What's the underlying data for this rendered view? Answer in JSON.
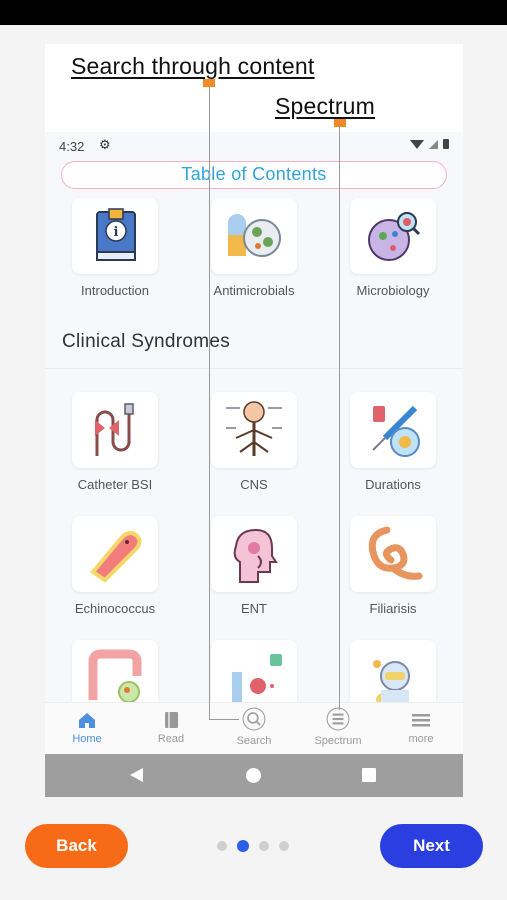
{
  "callouts": {
    "search": "Search through content",
    "spectrum": "Spectrum"
  },
  "status": {
    "time": "4:32"
  },
  "toc": {
    "title": "Table of Contents"
  },
  "top_items": [
    {
      "label": "Introduction",
      "icon": "info-book-icon"
    },
    {
      "label": "Antimicrobials",
      "icon": "pill-virus-icon"
    },
    {
      "label": "Microbiology",
      "icon": "petri-dish-icon"
    }
  ],
  "section": {
    "title": "Clinical Syndromes"
  },
  "syndromes": [
    {
      "label": "Catheter BSI",
      "icon": "catheter-icon"
    },
    {
      "label": "CNS",
      "icon": "nervous-system-icon"
    },
    {
      "label": "Durations",
      "icon": "syringe-vial-icon"
    },
    {
      "label": "Echinococcus",
      "icon": "parasite-icon"
    },
    {
      "label": "ENT",
      "icon": "head-ent-icon"
    },
    {
      "label": "Filiarisis",
      "icon": "worm-icon"
    },
    {
      "label": "",
      "icon": "intestine-icon"
    },
    {
      "label": "",
      "icon": "blood-sample-icon"
    },
    {
      "label": "",
      "icon": "protective-suit-icon"
    }
  ],
  "tabs": [
    {
      "label": "Home",
      "icon": "home-icon",
      "active": true
    },
    {
      "label": "Read",
      "icon": "book-icon"
    },
    {
      "label": "Search",
      "icon": "search-icon"
    },
    {
      "label": "Spectrum",
      "icon": "spectrum-icon"
    },
    {
      "label": "more",
      "icon": "menu-icon"
    }
  ],
  "buttons": {
    "back": "Back",
    "next": "Next"
  },
  "pagination": {
    "count": 4,
    "active_index": 1
  },
  "colors": {
    "accent_orange": "#f76a17",
    "accent_blue": "#2b3fe0",
    "toc_text": "#2fa5dc",
    "active_tab": "#4c8fe0"
  }
}
